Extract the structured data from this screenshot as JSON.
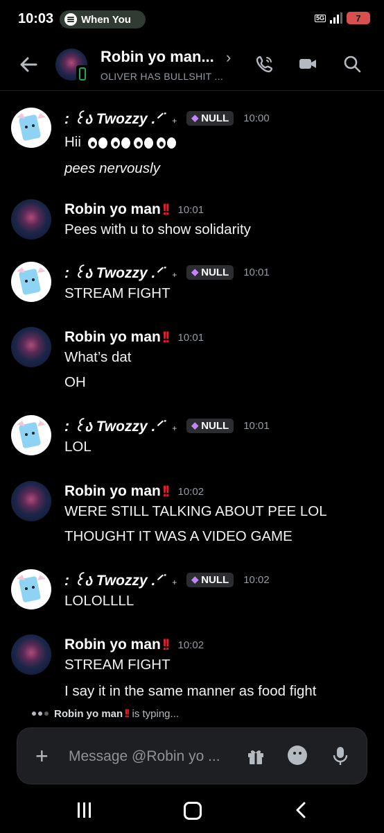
{
  "status": {
    "time": "10:03",
    "media_pill": "When You",
    "network": "5G",
    "battery": "7"
  },
  "header": {
    "title": "Robin yo man...",
    "subtitle": "OLIVER HAS BULLSHIT ..."
  },
  "messages": [
    {
      "author": ": ꒰ა Twozzy .ᐟ˙",
      "tag": "NULL",
      "time": "10:00",
      "lines": [
        "Hii",
        "pees nervously"
      ]
    },
    {
      "author": "Robin yo man",
      "time": "10:01",
      "lines": [
        "Pees with u to show solidarity"
      ]
    },
    {
      "author": ": ꒰ა Twozzy .ᐟ˙",
      "tag": "NULL",
      "time": "10:01",
      "lines": [
        "STREAM FIGHT"
      ]
    },
    {
      "author": "Robin yo man",
      "time": "10:01",
      "lines": [
        "What’s dat",
        "OH"
      ]
    },
    {
      "author": ": ꒰ა Twozzy .ᐟ˙",
      "tag": "NULL",
      "time": "10:01",
      "lines": [
        "LOL"
      ]
    },
    {
      "author": "Robin yo man",
      "time": "10:02",
      "lines": [
        "WERE STILL TALKING ABOUT PEE LOL",
        "THOUGHT IT WAS A VIDEO GAME"
      ]
    },
    {
      "author": ": ꒰ა Twozzy .ᐟ˙",
      "tag": "NULL",
      "time": "10:02",
      "lines": [
        "LOLOLLLL"
      ]
    },
    {
      "author": "Robin yo man",
      "time": "10:02",
      "lines": [
        "STREAM FIGHT",
        "I say it in the same manner as food fight"
      ]
    }
  ],
  "typing": {
    "user": "Robin yo man",
    "text": "is typing..."
  },
  "composer": {
    "placeholder": "Message @Robin yo ..."
  },
  "icons": {
    "back": "arrow-left-icon",
    "call": "phone-icon",
    "video": "video-camera-icon",
    "search": "search-icon",
    "add": "plus-icon",
    "gift": "gift-icon",
    "emoji": "emoji-icon",
    "mic": "microphone-icon"
  },
  "colors": {
    "background": "#000000",
    "text": "#f2f3f5",
    "muted": "#949ba4",
    "online_green": "#23a55a",
    "bang_red": "#e0202e",
    "nitro_purple": "#c084fc"
  }
}
